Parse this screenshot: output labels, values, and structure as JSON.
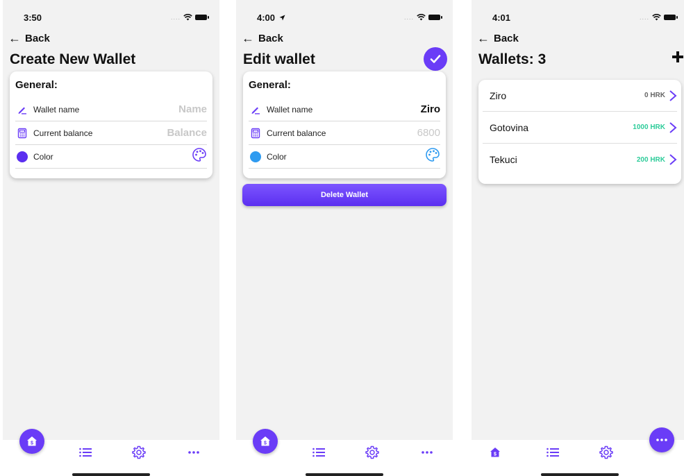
{
  "colors": {
    "accent": "#6a3cf7",
    "green": "#2ecc9a",
    "swatch_purple": "#5b2ff0",
    "swatch_blue": "#2f9bf0"
  },
  "screen1": {
    "time": "3:50",
    "back": "Back",
    "title": "Create New Wallet",
    "section": "General:",
    "wallet_name_label": "Wallet name",
    "wallet_name_placeholder": "Name",
    "balance_label": "Current balance",
    "balance_placeholder": "Balance",
    "color_label": "Color"
  },
  "screen2": {
    "time": "4:00",
    "back": "Back",
    "title": "Edit wallet",
    "section": "General:",
    "wallet_name_label": "Wallet name",
    "wallet_name_value": "Ziro",
    "balance_label": "Current balance",
    "balance_placeholder": "6800",
    "color_label": "Color",
    "delete_label": "Delete Wallet"
  },
  "screen3": {
    "time": "4:01",
    "back": "Back",
    "title": "Wallets: 3",
    "wallets": [
      {
        "name": "Ziro",
        "amount": "0 HRK"
      },
      {
        "name": "Gotovina",
        "amount": "1000 HRK"
      },
      {
        "name": "Tekuci",
        "amount": "200 HRK"
      }
    ]
  },
  "icons": [
    "arrow-left-icon",
    "pencil-icon",
    "calculator-icon",
    "palette-icon",
    "check-icon",
    "plus-icon",
    "chevron-right-icon",
    "home-icon",
    "list-icon",
    "gear-icon",
    "more-icon",
    "wifi-icon",
    "battery-icon",
    "location-arrow-icon"
  ]
}
